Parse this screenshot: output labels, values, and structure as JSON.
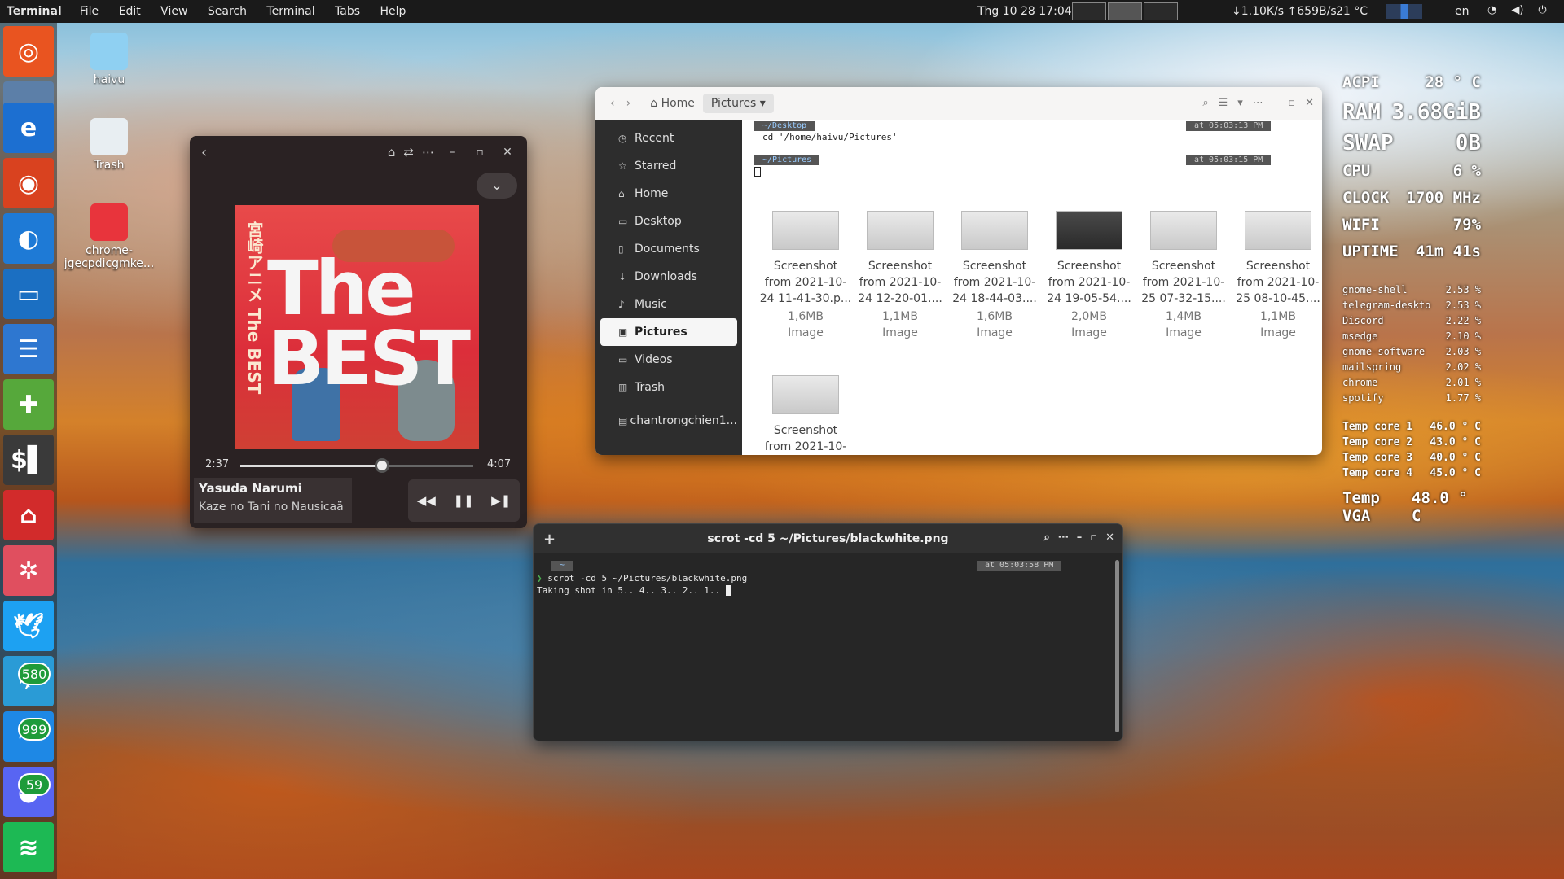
{
  "topbar": {
    "app": "Terminal",
    "menus": [
      "File",
      "Edit",
      "View",
      "Search",
      "Terminal",
      "Tabs",
      "Help"
    ],
    "clock": "Thg 10 28  17:04",
    "net": "↓1.10K/s ↑659B/s",
    "temp": "21 °C",
    "lang": "en"
  },
  "desktop_icons": [
    "haivu",
    "Trash",
    "chrome-jgecpdicgmke..."
  ],
  "dock": {
    "badges": [
      "580",
      "999",
      "59"
    ]
  },
  "music": {
    "elapsed": "2:37",
    "duration": "4:07",
    "progress": 0.61,
    "artist": "Yasuda Narumi",
    "title": "Kaze no Tani no Nausicaä",
    "cover_small": "宮崎アニメ The BEST",
    "cover_big": "The BEST"
  },
  "files": {
    "crumbs": [
      "Home",
      "Pictures"
    ],
    "sidebar": [
      "Recent",
      "Starred",
      "Home",
      "Desktop",
      "Documents",
      "Downloads",
      "Music",
      "Pictures",
      "Videos",
      "Trash",
      "chantrongchien1..."
    ],
    "selected": "Pictures",
    "prompt1_dir": "~/Desktop",
    "prompt1_time": "at 05:03:13 PM",
    "cmd1": "cd '/home/haivu/Pictures'",
    "prompt2_dir": "~/Pictures",
    "prompt2_time": "at 05:03:15 PM",
    "items": [
      {
        "name1": "Screenshot",
        "name2": "from 2021-10-",
        "name3": "24 11-41-30.p...",
        "size": "1,6MB",
        "type": "Image"
      },
      {
        "name1": "Screenshot",
        "name2": "from 2021-10-",
        "name3": "24 12-20-01....",
        "size": "1,1MB",
        "type": "Image"
      },
      {
        "name1": "Screenshot",
        "name2": "from 2021-10-",
        "name3": "24 18-44-03....",
        "size": "1,6MB",
        "type": "Image"
      },
      {
        "name1": "Screenshot",
        "name2": "from 2021-10-",
        "name3": "24 19-05-54....",
        "size": "2,0MB",
        "type": "Image"
      },
      {
        "name1": "Screenshot",
        "name2": "from 2021-10-",
        "name3": "25 07-32-15....",
        "size": "1,4MB",
        "type": "Image"
      },
      {
        "name1": "Screenshot",
        "name2": "from 2021-10-",
        "name3": "25 08-10-45....",
        "size": "1,1MB",
        "type": "Image"
      },
      {
        "name1": "Screenshot",
        "name2": "from 2021-10-",
        "name3": "",
        "size": "",
        "type": ""
      }
    ]
  },
  "terminal": {
    "title": "scrot -cd 5 ~/Pictures/blackwhite.png",
    "prompt_dir": "~",
    "prompt_time": "at 05:03:58 PM",
    "line1": "scrot -cd 5 ~/Pictures/blackwhite.png",
    "line2": "Taking shot in 5.. 4.. 3.. 2.. 1.."
  },
  "conky": {
    "acpi": [
      "ACPI",
      "28 ° C"
    ],
    "ram": [
      "RAM",
      "3.68GiB"
    ],
    "swap": [
      "SWAP",
      "0B"
    ],
    "cpu": [
      "CPU",
      "6 %"
    ],
    "clock": [
      "CLOCK",
      "1700 MHz"
    ],
    "wifi": [
      "WIFI",
      "79%"
    ],
    "uptime": [
      "UPTIME",
      "41m 41s"
    ],
    "procs": [
      [
        "gnome-shell",
        "2.53 %"
      ],
      [
        "telegram-deskto",
        "2.53 %"
      ],
      [
        "Discord",
        "2.22 %"
      ],
      [
        "msedge",
        "2.10 %"
      ],
      [
        "gnome-software",
        "2.03 %"
      ],
      [
        "mailspring",
        "2.02 %"
      ],
      [
        "chrome",
        "2.01 %"
      ],
      [
        "spotify",
        "1.77 %"
      ]
    ],
    "temps": [
      [
        "Temp core 1",
        "46.0 ° C"
      ],
      [
        "Temp core 2",
        "43.0 ° C"
      ],
      [
        "Temp core 3",
        "40.0 ° C"
      ],
      [
        "Temp core 4",
        "45.0 ° C"
      ]
    ],
    "vga": [
      "Temp VGA",
      "48.0 ° C"
    ]
  },
  "colors": {
    "accent": "#3a7bd5",
    "badge": "#1e9b3a"
  }
}
